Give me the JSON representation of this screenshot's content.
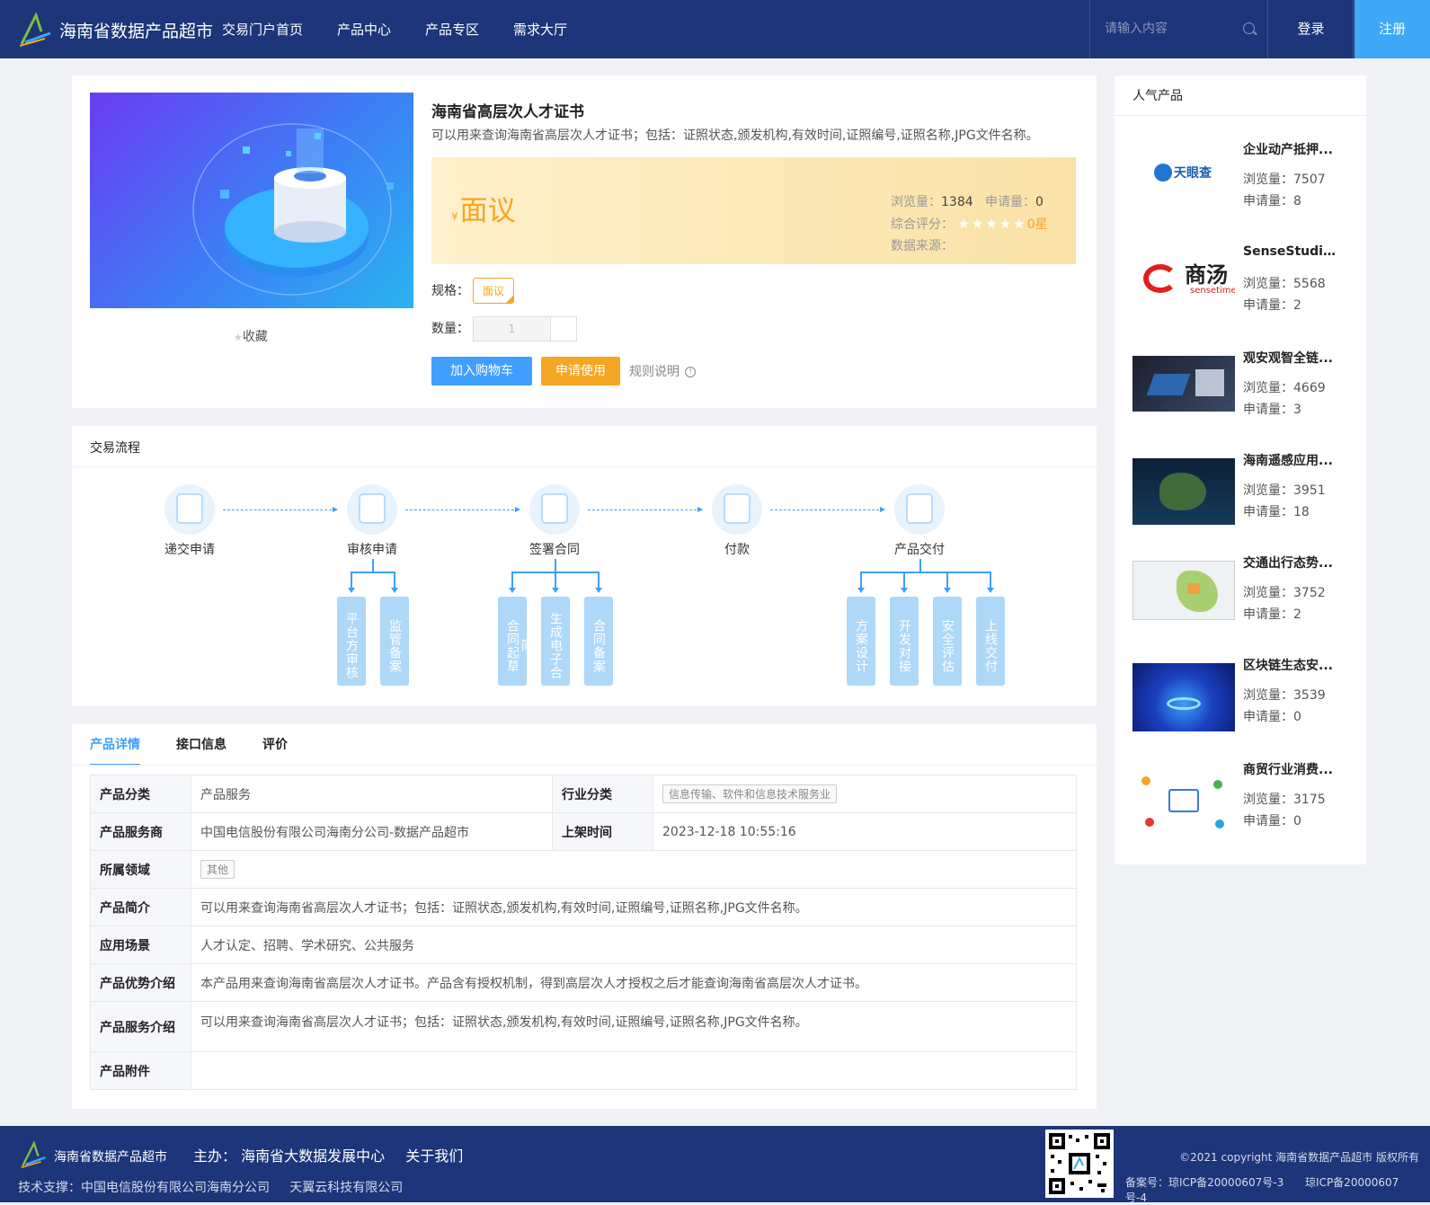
{
  "header": {
    "brand": "海南省数据产品超市",
    "nav": [
      "交易门户首页",
      "产品中心",
      "产品专区",
      "需求大厅"
    ],
    "search_placeholder": "请输入内容",
    "login": "登录",
    "register": "注册"
  },
  "product": {
    "title": "海南省高层次人才证书",
    "desc": "可以用来查询海南省高层次人才证书；包括：证照状态,颁发机构,有效时间,证照编号,证照名称,JPG文件名称。",
    "favorite": "收藏",
    "price_symbol": "¥",
    "price": "面议",
    "views_label": "浏览量：",
    "views": "1384",
    "applies_label": "申请量：",
    "applies": "0",
    "rating_label": "综合评分：",
    "rating_value": "0星",
    "rating_stars": 0,
    "source_label": "数据来源：",
    "spec_label": "规格：",
    "spec_value": "面议",
    "qty_label": "数量：",
    "qty_value": "1",
    "add_cart": "加入购物车",
    "apply": "申请使用",
    "rule": "规则说明"
  },
  "flow": {
    "title": "交易流程",
    "steps": [
      "递交申请",
      "审核申请",
      "签署合同",
      "付款",
      "产品交付"
    ],
    "sub_review": [
      "平台方审核",
      "监管备案"
    ],
    "sub_contract": [
      "合同起草",
      "生成电子合同",
      "合同备案"
    ],
    "sub_delivery": [
      "方案设计",
      "开发对接",
      "安全评估",
      "上线交付"
    ]
  },
  "detail": {
    "tabs": [
      "产品详情",
      "接口信息",
      "评价"
    ],
    "rows": {
      "category_label": "产品分类",
      "category": "产品服务",
      "industry_label": "行业分类",
      "industry": "信息传输、软件和信息技术服务业",
      "provider_label": "产品服务商",
      "provider": "中国电信股份有限公司海南分公司-数据产品超市",
      "time_label": "上架时间",
      "time": "2023-12-18 10:55:16",
      "domain_label": "所属领域",
      "domain": "其他",
      "intro_label": "产品简介",
      "intro": "可以用来查询海南省高层次人才证书；包括：证照状态,颁发机构,有效时间,证照编号,证照名称,JPG文件名称。",
      "scene_label": "应用场景",
      "scene": "人才认定、招聘、学术研究、公共服务",
      "adv_label": "产品优势介绍",
      "adv": "本产品用来查询海南省高层次人才证书。产品含有授权机制，得到高层次人才授权之后才能查询海南省高层次人才证书。",
      "service_label": "产品服务介绍",
      "service": "可以用来查询海南省高层次人才证书；包括：证照状态,颁发机构,有效时间,证照编号,证照名称,JPG文件名称。",
      "attach_label": "产品附件"
    }
  },
  "popular": {
    "title": "人气产品",
    "views_label": "浏览量：",
    "applies_label": "申请量：",
    "items": [
      {
        "name": "企业动产抵押...",
        "views": "7507",
        "applies": "8"
      },
      {
        "name": "SenseStudio...",
        "views": "5568",
        "applies": "2"
      },
      {
        "name": "观安观智全链...",
        "views": "4669",
        "applies": "3"
      },
      {
        "name": "海南遥感应用...",
        "views": "3951",
        "applies": "18"
      },
      {
        "name": "交通出行态势...",
        "views": "3752",
        "applies": "2"
      },
      {
        "name": "区块链生态安...",
        "views": "3539",
        "applies": "0"
      },
      {
        "name": "商贸行业消费...",
        "views": "3175",
        "applies": "0"
      }
    ],
    "logo_text_1": "天眼查",
    "logo_text_2": "商汤",
    "logo_text_2b": "sensetime"
  },
  "footer": {
    "brand": "海南省数据产品超市",
    "host": "主办： 海南省大数据发展中心",
    "about": "关于我们",
    "tech": "技术支撑：中国电信股份有限公司海南分公司     天翼云科技有限公司",
    "copyright": "©2021 copyright 海南省数据产品超市 版权所有",
    "icp1": "备案号：琼ICP备20000607号-3",
    "icp2": "琼ICP备20000607号-4"
  },
  "colors": {
    "nav_bg": "#1d3579",
    "accent": "#409eff",
    "orange": "#f5a623",
    "register_bg": "#3da8f5"
  }
}
